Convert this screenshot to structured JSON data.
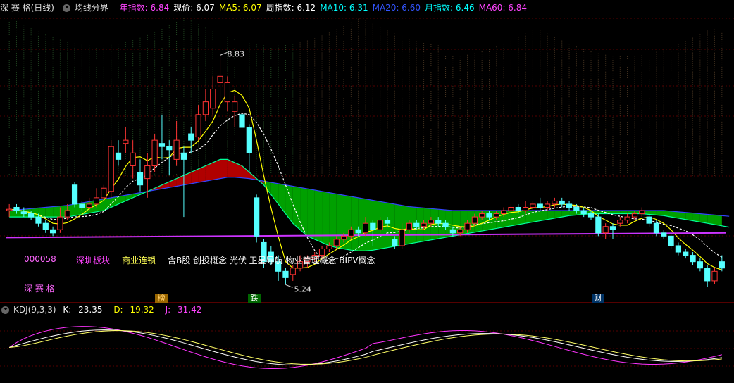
{
  "header": {
    "stock_name": "深 赛 格(日线)",
    "indicator_name": "均线分界",
    "items": [
      {
        "label": "年指数:",
        "value": "6.84",
        "color": "#ff44ff"
      },
      {
        "label": "现价:",
        "value": "6.07",
        "color": "#ffffff"
      },
      {
        "label": "MA5:",
        "value": "6.07",
        "color": "#ffff00"
      },
      {
        "label": "周指数:",
        "value": "6.12",
        "color": "#ffffff"
      },
      {
        "label": "MA10:",
        "value": "6.31",
        "color": "#00ffff"
      },
      {
        "label": "MA20:",
        "value": "6.60",
        "color": "#3355ff"
      },
      {
        "label": "月指数:",
        "value": "6.46",
        "color": "#00ffff"
      },
      {
        "label": "MA60:",
        "value": "6.84",
        "color": "#ff44ff"
      }
    ]
  },
  "stock_info": {
    "code": "000058",
    "board": "深圳板块",
    "industry": "商业连锁",
    "concepts": "含B股 创投概念 光伏 卫星导航 物业管理概念 BIPV概念",
    "name": "深 赛 格"
  },
  "annotations": {
    "high_label": "8.83",
    "low_label": "5.24",
    "badge_1": "榜",
    "badge_2": "跌",
    "badge_3": "财"
  },
  "kdj": {
    "title": "KDJ(9,3,3)",
    "k_label": "K:",
    "k_value": "23.35",
    "d_label": "D:",
    "d_value": "19.32",
    "j_label": "J:",
    "j_value": "31.42"
  },
  "colors": {
    "up": "#ff3333",
    "down": "#55ffff",
    "fill_up": "#b00000",
    "fill_down": "#00a000",
    "ma5": "#ffff00",
    "ma10": "#ffffff",
    "ma20": "#00ff99",
    "ma60": "#3344ff",
    "year_line": "#cc33ff",
    "k_line": "#ffffff",
    "d_line": "#ffff66",
    "j_line": "#ff33ff"
  },
  "chart_data": {
    "type": "candlestick",
    "y_range": [
      5.2,
      8.9
    ],
    "candles": [
      {
        "o": 6.4,
        "c": 6.42,
        "h": 6.5,
        "l": 6.3
      },
      {
        "o": 6.45,
        "c": 6.4,
        "h": 6.5,
        "l": 6.35
      },
      {
        "o": 6.38,
        "c": 6.35,
        "h": 6.45,
        "l": 6.3
      },
      {
        "o": 6.35,
        "c": 6.3,
        "h": 6.4,
        "l": 6.25
      },
      {
        "o": 6.3,
        "c": 6.2,
        "h": 6.35,
        "l": 6.15
      },
      {
        "o": 6.2,
        "c": 6.1,
        "h": 6.25,
        "l": 6.05
      },
      {
        "o": 6.1,
        "c": 6.05,
        "h": 6.15,
        "l": 6.0
      },
      {
        "o": 6.1,
        "c": 6.3,
        "h": 6.45,
        "l": 6.05
      },
      {
        "o": 6.3,
        "c": 6.4,
        "h": 6.5,
        "l": 6.25
      },
      {
        "o": 6.8,
        "c": 6.5,
        "h": 6.85,
        "l": 6.45
      },
      {
        "o": 6.5,
        "c": 6.45,
        "h": 6.55,
        "l": 6.4
      },
      {
        "o": 6.45,
        "c": 6.5,
        "h": 6.6,
        "l": 6.4
      },
      {
        "o": 6.5,
        "c": 6.6,
        "h": 6.75,
        "l": 6.45
      },
      {
        "o": 6.6,
        "c": 6.75,
        "h": 6.8,
        "l": 6.55
      },
      {
        "o": 6.7,
        "c": 7.4,
        "h": 7.5,
        "l": 6.6
      },
      {
        "o": 7.3,
        "c": 7.2,
        "h": 7.5,
        "l": 7.1
      },
      {
        "o": 7.45,
        "c": 7.5,
        "h": 7.7,
        "l": 7.3
      },
      {
        "o": 7.1,
        "c": 7.3,
        "h": 7.5,
        "l": 6.9
      },
      {
        "o": 7.0,
        "c": 6.8,
        "h": 7.2,
        "l": 6.7
      },
      {
        "o": 6.9,
        "c": 7.1,
        "h": 7.3,
        "l": 6.6
      },
      {
        "o": 7.1,
        "c": 7.5,
        "h": 7.6,
        "l": 7.0
      },
      {
        "o": 7.45,
        "c": 7.4,
        "h": 7.9,
        "l": 7.2
      },
      {
        "o": 7.4,
        "c": 7.35,
        "h": 7.5,
        "l": 6.95
      },
      {
        "o": 7.2,
        "c": 7.5,
        "h": 7.8,
        "l": 7.1
      },
      {
        "o": 7.3,
        "c": 7.2,
        "h": 7.4,
        "l": 6.3
      },
      {
        "o": 7.6,
        "c": 7.5,
        "h": 7.7,
        "l": 7.3
      },
      {
        "o": 7.55,
        "c": 7.9,
        "h": 8.05,
        "l": 7.5
      },
      {
        "o": 7.9,
        "c": 8.1,
        "h": 8.3,
        "l": 7.8
      },
      {
        "o": 8.0,
        "c": 8.3,
        "h": 8.5,
        "l": 7.9
      },
      {
        "o": 8.4,
        "c": 8.5,
        "h": 8.83,
        "l": 8.0
      },
      {
        "o": 8.1,
        "c": 8.4,
        "h": 8.5,
        "l": 7.95
      },
      {
        "o": 7.95,
        "c": 8.1,
        "h": 8.2,
        "l": 7.7
      },
      {
        "o": 7.9,
        "c": 7.7,
        "h": 8.1,
        "l": 7.6
      },
      {
        "o": 7.7,
        "c": 7.3,
        "h": 7.75,
        "l": 7.0
      },
      {
        "o": 6.6,
        "c": 6.0,
        "h": 6.65,
        "l": 5.9
      },
      {
        "o": 5.9,
        "c": 5.6,
        "h": 5.95,
        "l": 5.5
      },
      {
        "o": 5.75,
        "c": 5.6,
        "h": 5.85,
        "l": 5.55
      },
      {
        "o": 5.6,
        "c": 5.45,
        "h": 5.7,
        "l": 5.3
      },
      {
        "o": 5.45,
        "c": 5.35,
        "h": 5.5,
        "l": 5.24
      },
      {
        "o": 5.4,
        "c": 5.5,
        "h": 5.55,
        "l": 5.3
      },
      {
        "o": 5.5,
        "c": 5.6,
        "h": 5.7,
        "l": 5.45
      },
      {
        "o": 5.6,
        "c": 5.65,
        "h": 5.7,
        "l": 5.5
      },
      {
        "o": 5.65,
        "c": 5.7,
        "h": 5.75,
        "l": 5.6
      },
      {
        "o": 5.7,
        "c": 5.8,
        "h": 5.85,
        "l": 5.65
      },
      {
        "o": 5.8,
        "c": 5.85,
        "h": 5.9,
        "l": 5.75
      },
      {
        "o": 5.85,
        "c": 5.95,
        "h": 6.0,
        "l": 5.8
      },
      {
        "o": 5.95,
        "c": 6.0,
        "h": 6.05,
        "l": 5.9
      },
      {
        "o": 6.0,
        "c": 6.1,
        "h": 6.15,
        "l": 5.95
      },
      {
        "o": 6.1,
        "c": 6.05,
        "h": 6.15,
        "l": 6.0
      },
      {
        "o": 6.05,
        "c": 6.2,
        "h": 6.3,
        "l": 6.0
      },
      {
        "o": 6.2,
        "c": 6.1,
        "h": 6.25,
        "l": 5.85
      },
      {
        "o": 6.1,
        "c": 6.25,
        "h": 6.3,
        "l": 6.05
      },
      {
        "o": 6.25,
        "c": 6.2,
        "h": 6.3,
        "l": 6.15
      },
      {
        "o": 5.95,
        "c": 5.85,
        "h": 6.0,
        "l": 5.8
      },
      {
        "o": 5.85,
        "c": 6.1,
        "h": 6.2,
        "l": 5.8
      },
      {
        "o": 6.1,
        "c": 6.2,
        "h": 6.25,
        "l": 6.05
      },
      {
        "o": 6.2,
        "c": 6.15,
        "h": 6.25,
        "l": 6.1
      },
      {
        "o": 6.15,
        "c": 6.2,
        "h": 6.25,
        "l": 6.1
      },
      {
        "o": 6.2,
        "c": 6.25,
        "h": 6.3,
        "l": 6.15
      },
      {
        "o": 6.25,
        "c": 6.2,
        "h": 6.3,
        "l": 6.15
      },
      {
        "o": 6.2,
        "c": 6.15,
        "h": 6.25,
        "l": 6.1
      },
      {
        "o": 6.1,
        "c": 6.05,
        "h": 6.15,
        "l": 6.0
      },
      {
        "o": 6.05,
        "c": 6.1,
        "h": 6.15,
        "l": 6.0
      },
      {
        "o": 6.1,
        "c": 6.2,
        "h": 6.25,
        "l": 6.05
      },
      {
        "o": 6.2,
        "c": 6.3,
        "h": 6.35,
        "l": 6.15
      },
      {
        "o": 6.3,
        "c": 6.35,
        "h": 6.4,
        "l": 6.25
      },
      {
        "o": 6.35,
        "c": 6.3,
        "h": 6.4,
        "l": 6.25
      },
      {
        "o": 6.3,
        "c": 6.35,
        "h": 6.4,
        "l": 6.25
      },
      {
        "o": 6.35,
        "c": 6.4,
        "h": 6.45,
        "l": 6.3
      },
      {
        "o": 6.4,
        "c": 6.45,
        "h": 6.5,
        "l": 6.35
      },
      {
        "o": 6.45,
        "c": 6.4,
        "h": 6.5,
        "l": 6.35
      },
      {
        "o": 6.4,
        "c": 6.45,
        "h": 6.55,
        "l": 6.35
      },
      {
        "o": 6.45,
        "c": 6.5,
        "h": 6.55,
        "l": 6.4
      },
      {
        "o": 6.5,
        "c": 6.45,
        "h": 6.6,
        "l": 6.4
      },
      {
        "o": 6.45,
        "c": 6.5,
        "h": 6.55,
        "l": 6.4
      },
      {
        "o": 6.5,
        "c": 6.55,
        "h": 6.6,
        "l": 6.45
      },
      {
        "o": 6.55,
        "c": 6.5,
        "h": 6.6,
        "l": 6.45
      },
      {
        "o": 6.5,
        "c": 6.45,
        "h": 6.55,
        "l": 6.4
      },
      {
        "o": 6.45,
        "c": 6.4,
        "h": 6.5,
        "l": 6.35
      },
      {
        "o": 6.4,
        "c": 6.35,
        "h": 6.45,
        "l": 6.3
      },
      {
        "o": 6.35,
        "c": 6.3,
        "h": 6.4,
        "l": 6.25
      },
      {
        "o": 6.3,
        "c": 6.05,
        "h": 6.35,
        "l": 6.0
      },
      {
        "o": 6.05,
        "c": 6.15,
        "h": 6.2,
        "l": 5.95
      },
      {
        "o": 6.15,
        "c": 6.1,
        "h": 6.2,
        "l": 5.95
      },
      {
        "o": 6.2,
        "c": 6.25,
        "h": 6.3,
        "l": 6.15
      },
      {
        "o": 6.25,
        "c": 6.3,
        "h": 6.35,
        "l": 6.2
      },
      {
        "o": 6.3,
        "c": 6.35,
        "h": 6.4,
        "l": 6.25
      },
      {
        "o": 6.35,
        "c": 6.4,
        "h": 6.45,
        "l": 6.3
      },
      {
        "o": 6.3,
        "c": 6.2,
        "h": 6.35,
        "l": 6.15
      },
      {
        "o": 6.2,
        "c": 6.05,
        "h": 6.25,
        "l": 6.0
      },
      {
        "o": 6.05,
        "c": 6.0,
        "h": 6.1,
        "l": 5.95
      },
      {
        "o": 6.0,
        "c": 5.85,
        "h": 6.05,
        "l": 5.8
      },
      {
        "o": 5.85,
        "c": 5.75,
        "h": 5.9,
        "l": 5.7
      },
      {
        "o": 5.75,
        "c": 5.7,
        "h": 5.8,
        "l": 5.65
      },
      {
        "o": 5.7,
        "c": 5.6,
        "h": 5.75,
        "l": 5.55
      },
      {
        "o": 5.6,
        "c": 5.5,
        "h": 5.65,
        "l": 5.45
      },
      {
        "o": 5.5,
        "c": 5.3,
        "h": 5.55,
        "l": 5.2
      },
      {
        "o": 5.3,
        "c": 5.45,
        "h": 5.5,
        "l": 5.25
      },
      {
        "o": 5.6,
        "c": 5.5,
        "h": 5.7,
        "l": 5.45
      }
    ],
    "ma60": [
      6.4,
      6.41,
      6.42,
      6.43,
      6.44,
      6.45,
      6.46,
      6.47,
      6.48,
      6.5,
      6.52,
      6.54,
      6.56,
      6.58,
      6.6,
      6.62,
      6.64,
      6.66,
      6.68,
      6.7,
      6.72,
      6.74,
      6.76,
      6.78,
      6.8,
      6.82,
      6.84,
      6.86,
      6.88,
      6.9,
      6.92,
      6.92,
      6.91,
      6.9,
      6.88,
      6.86,
      6.84,
      6.82,
      6.8,
      6.78,
      6.76,
      6.74,
      6.72,
      6.7,
      6.68,
      6.66,
      6.64,
      6.62,
      6.6,
      6.58,
      6.56,
      6.54,
      6.52,
      6.5,
      6.48,
      6.46,
      6.45,
      6.44,
      6.43,
      6.42,
      6.41,
      6.4,
      6.4,
      6.4,
      6.4,
      6.4,
      6.4,
      6.4,
      6.4,
      6.4,
      6.4,
      6.4,
      6.4,
      6.4,
      6.4,
      6.4,
      6.4,
      6.4,
      6.4,
      6.4,
      6.4,
      6.4,
      6.4,
      6.4,
      6.4,
      6.4,
      6.4,
      6.4,
      6.4,
      6.4,
      6.4,
      6.39,
      6.38,
      6.37,
      6.36,
      6.35,
      6.34,
      6.33,
      6.32,
      6.31
    ],
    "ma20": [
      6.3,
      6.3,
      6.3,
      6.3,
      6.3,
      6.3,
      6.3,
      6.3,
      6.3,
      6.32,
      6.34,
      6.36,
      6.38,
      6.4,
      6.45,
      6.5,
      6.55,
      6.6,
      6.65,
      6.7,
      6.75,
      6.8,
      6.85,
      6.9,
      6.95,
      7.0,
      7.05,
      7.1,
      7.15,
      7.2,
      7.2,
      7.15,
      7.1,
      7.0,
      6.9,
      6.8,
      6.65,
      6.5,
      6.35,
      6.2,
      6.1,
      6.0,
      5.95,
      5.9,
      5.85,
      5.82,
      5.8,
      5.78,
      5.77,
      5.77,
      5.78,
      5.8,
      5.82,
      5.84,
      5.86,
      5.88,
      5.9,
      5.92,
      5.94,
      5.96,
      5.98,
      6.0,
      6.02,
      6.04,
      6.06,
      6.08,
      6.1,
      6.12,
      6.14,
      6.16,
      6.18,
      6.2,
      6.22,
      6.24,
      6.26,
      6.28,
      6.3,
      6.32,
      6.33,
      6.34,
      6.35,
      6.35,
      6.35,
      6.35,
      6.35,
      6.35,
      6.35,
      6.35,
      6.34,
      6.33,
      6.32,
      6.3,
      6.28,
      6.26,
      6.24,
      6.22,
      6.2,
      6.18,
      6.16,
      6.14
    ]
  }
}
